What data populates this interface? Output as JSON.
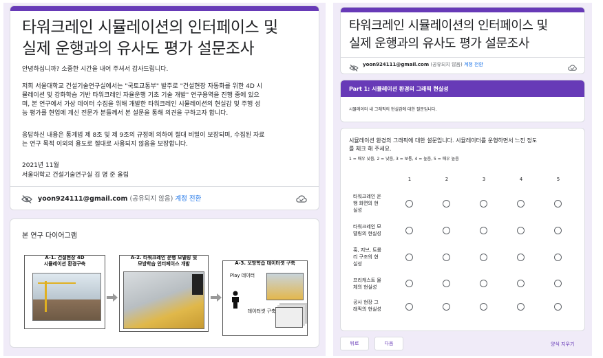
{
  "left": {
    "title": "타워크레인 시뮬레이션의 인터페이스 및\n실제 운행과의 유사도 평가 설문조사",
    "greeting": "안녕하십니까? 소중한 시간을 내어 주셔서 감사드립니다.",
    "body1_l1": "저희 서울대학교 건설기술연구실에서는 \"국토교통부\" 발주로 \"건설현장 자동화를 위한 4D 시",
    "body1_l2": "뮬레이션 및 강화학습 기반 타워크레인 자율운행 기초 기술 개발\" 연구용역을 진행 중에 있으",
    "body1_l3": "며, 본 연구에서 가상 데이터 수집을 위해 개발한 타워크레인 시뮬레이션의 현실감 및 주행 성",
    "body1_l4": "능 평가를 현업에 계신 전문가 분들께서 본 설문을 통해 의견을 구하고자 합니다.",
    "body2_l1": "응답하신 내용은 통계법 제 8조 및 제 9조의 규정에 의하여 절대 비밀이 보장되며, 수집된 자료",
    "body2_l2": "는 연구 목적 이외의 용도로 절대로 사용되지 않음을 보장합니다.",
    "date": "2021년 11월",
    "signature": "서울대학교 건설기술연구실 김 명 준 올림",
    "account_email": "yoon924111@gmail.com",
    "account_note": "(공유되지 않음)",
    "account_switch": "계정 전환",
    "diagram_section_title": "본 연구 다이어그램",
    "diagram": {
      "a1_l1": "A-1. 건설현장 4D",
      "a1_l2": "시뮬레이션 환경구축",
      "a2_l1": "A-2. 타워크레인 운행 모델링 및",
      "a2_l2": "모방학습 인터페이스 개발",
      "a3": "A-3. 모방학습 데이터셋 구축",
      "play_data": "Play 데이터",
      "dataset_build": "데이터셋 구축"
    }
  },
  "right": {
    "title": "타워크레인 시뮬레이션의 인터페이스 및\n실제 운행과의 유사도 평가 설문조사",
    "account_email": "yoon924111@gmail.com",
    "account_note": "(공유되지 않음)",
    "account_switch": "계정 전환",
    "section_header": "Part 1: 시뮬레이션 환경의 그래픽 현실성",
    "section_desc": "시뮬레이터 내 그래픽의 현실감에 대한 질문입니다.",
    "question_l1": "시뮬레이션 환경의 그래픽에 대한 설문입니다. 시뮬레이터를 운행하면서 느낀 정도",
    "question_l2": "를 체크 해 주세요.",
    "scale_legend": "1 = 매우 낮음, 2 = 낮음, 3 = 보통, 4 = 높음, 5 = 매우 높음",
    "columns": [
      "1",
      "2",
      "3",
      "4",
      "5"
    ],
    "rows": [
      [
        "타워크레인 운",
        "행 화면의 현",
        "실성"
      ],
      [
        "타워크레인 모",
        "델링의 현실성"
      ],
      [
        "훅, 지브, 트롤",
        "리 구조의 현",
        "실성"
      ],
      [
        "프리캐스트 물",
        "체의 현실성"
      ],
      [
        "공사 현장 그",
        "래픽의 현실성"
      ]
    ],
    "back_button": "뒤로",
    "next_button": "다음",
    "clear_form": "양식 지우기"
  },
  "colors": {
    "accent": "#673ab7",
    "link": "#1a73e8",
    "panel_bg": "#f0ebf8"
  }
}
